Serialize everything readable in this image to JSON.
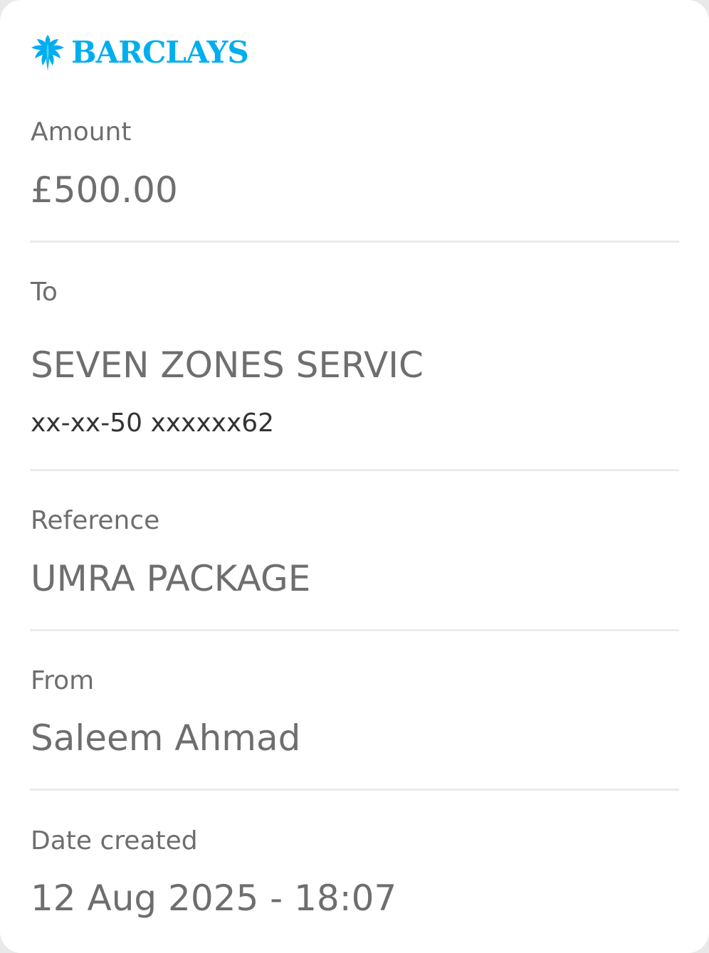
{
  "brand": {
    "name": "BARCLAYS",
    "color": "#00aeef",
    "logo_icon": "eagle-icon"
  },
  "amount": {
    "label": "Amount",
    "value": "£500.00"
  },
  "to": {
    "label": "To",
    "payee_name": "SEVEN ZONES SERVIC",
    "account": "xx-xx-50 xxxxxx62"
  },
  "reference": {
    "label": "Reference",
    "value": "UMRA PACKAGE"
  },
  "from": {
    "label": "From",
    "value": "Saleem Ahmad"
  },
  "date_created": {
    "label": "Date created",
    "value": "12 Aug 2025 - 18:07"
  }
}
